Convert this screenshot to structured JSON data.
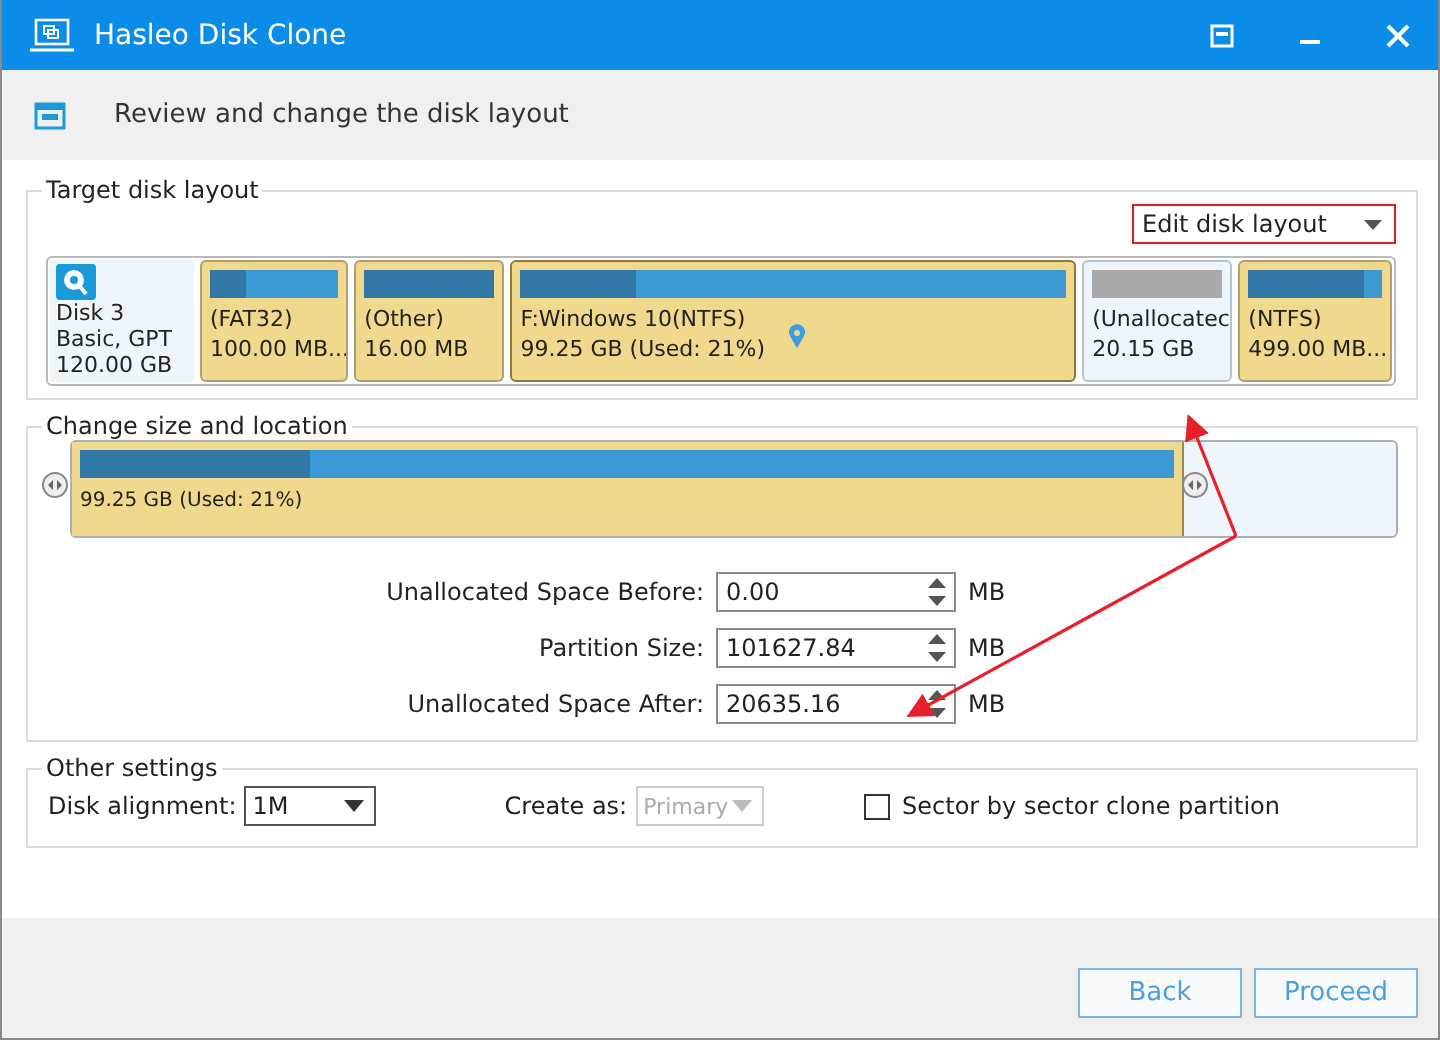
{
  "window": {
    "title": "Hasleo Disk Clone"
  },
  "header": {
    "text": "Review and change the disk layout"
  },
  "target_disk_layout": {
    "legend": "Target disk layout",
    "mode_dropdown": {
      "value": "Edit disk layout"
    },
    "disk": {
      "name": "Disk 3",
      "type": "Basic, GPT",
      "size": "120.00 GB"
    },
    "partitions": [
      {
        "kind": "partition",
        "label": "(FAT32)",
        "size": "100.00 MB...",
        "level": 0.28,
        "selected": false
      },
      {
        "kind": "partition",
        "label": "(Other)",
        "size": "16.00 MB",
        "level": 1.0,
        "selected": false
      },
      {
        "kind": "partition",
        "label": "F:Windows 10(NTFS)",
        "size": "99.25 GB (Used: 21%)",
        "level": 0.21,
        "selected": true
      },
      {
        "kind": "unallocated",
        "label": "(Unallocatec",
        "size": "20.15 GB",
        "selected": false
      },
      {
        "kind": "partition",
        "label": "(NTFS)",
        "size": "499.00 MB...",
        "level": 0.86,
        "selected": false
      }
    ]
  },
  "change_size_and_location": {
    "legend": "Change size and location",
    "used": {
      "level": 0.21
    },
    "bar_text": "99.25 GB (Used: 21%)",
    "fields": [
      {
        "label": "Unallocated Space Before:",
        "value": "0.00",
        "unit": "MB"
      },
      {
        "label": "Partition Size:",
        "value": "101627.84",
        "unit": "MB"
      },
      {
        "label": "Unallocated Space After:",
        "value": "20635.16",
        "unit": "MB"
      }
    ]
  },
  "other_settings": {
    "legend": "Other settings",
    "disk_alignment": {
      "label": "Disk alignment:",
      "value": "1M",
      "disabled": false
    },
    "create_as": {
      "label": "Create as:",
      "value": "Primary",
      "disabled": true
    },
    "sector_by_sector": {
      "label": "Sector by sector clone partition",
      "checked": false
    }
  },
  "buttons": [
    {
      "label": "Back"
    },
    {
      "label": "Proceed"
    }
  ]
}
